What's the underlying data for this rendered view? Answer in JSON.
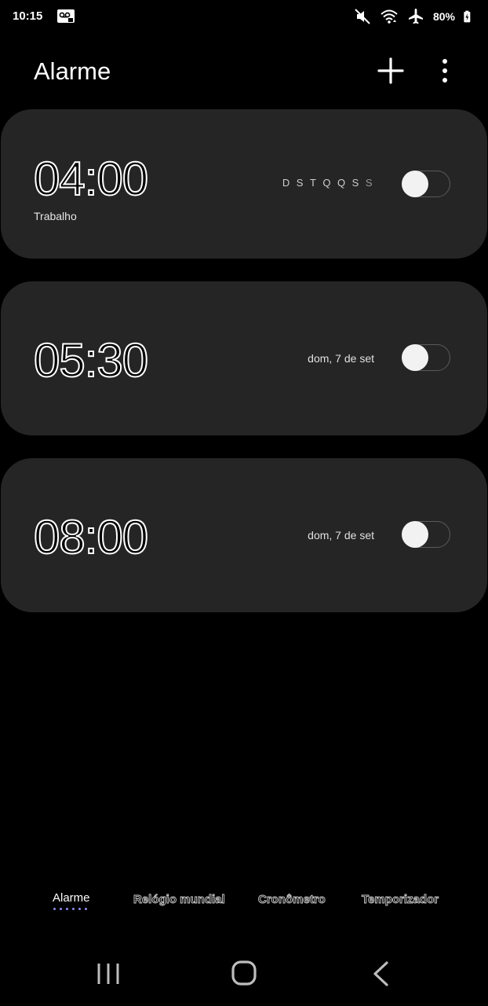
{
  "status_bar": {
    "time": "10:15",
    "battery": "80%",
    "icons": [
      "voicemail-icon",
      "mute-icon",
      "wifi-icon",
      "airplane-mode-icon",
      "battery-charging-icon"
    ]
  },
  "header": {
    "title": "Alarme",
    "add_icon": "plus-icon",
    "more_icon": "more-vertical-icon"
  },
  "alarms": [
    {
      "time": "04:00",
      "label": "Trabalho",
      "days": [
        "D",
        "S",
        "T",
        "Q",
        "Q",
        "S",
        "S"
      ],
      "date": "",
      "enabled": false
    },
    {
      "time": "05:30",
      "label": "",
      "days": [],
      "date": "dom, 7 de set",
      "enabled": false
    },
    {
      "time": "08:00",
      "label": "",
      "days": [],
      "date": "dom, 7 de set",
      "enabled": false
    }
  ],
  "tabs": {
    "alarm": "Alarme",
    "world_clock": "Relógio mundial",
    "stopwatch": "Cronômetro",
    "timer": "Temporizador",
    "active": "alarm"
  },
  "colors": {
    "background": "#000000",
    "card": "#252525",
    "tab_indicator": "#8f8cf0"
  }
}
